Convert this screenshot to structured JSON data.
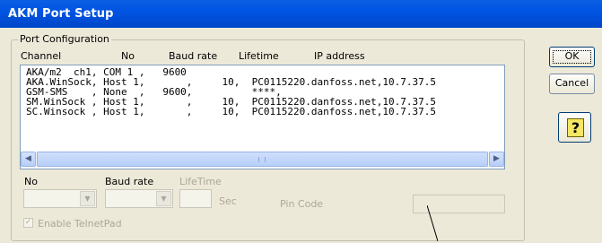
{
  "window": {
    "title": "AKM Port Setup"
  },
  "group": {
    "legend": "Port Configuration"
  },
  "columns": {
    "channel": "Channel",
    "no": "No",
    "baud_rate": "Baud rate",
    "lifetime": "Lifetime",
    "ip_address": "IP address"
  },
  "list": {
    "rows": [
      "AKA/m2  ch1, COM 1 ,   9600",
      "AKA.WinSock, Host 1,       ,     10,  PC0115220.danfoss.net,10.7.37.5",
      "GSM-SMS    , None  ,   9600,          ****,",
      "SM.WinSock , Host 1,       ,     10,  PC0115220.danfoss.net,10.7.37.5",
      "SC.Winsock , Host 1,       ,     10,  PC0115220.danfoss.net,10.7.37.5"
    ]
  },
  "form": {
    "no_label": "No",
    "baud_label": "Baud rate",
    "lifetime_label": "LifeTime",
    "sec_label": "Sec",
    "pin_label": "Pin Code",
    "telnet_label": "Enable TelnetPad",
    "telnet_checked": true
  },
  "buttons": {
    "ok": "OK",
    "cancel": "Cancel",
    "help": "?"
  },
  "icons": {
    "left": "scroll-left-arrow",
    "right": "scroll-right-arrow",
    "dropdown": "chevron-down",
    "help": "help-question-icon"
  },
  "colors": {
    "title_bar": "#0054e3",
    "dialog_bg": "#ece9d8",
    "selection": "#316ac5",
    "disabled_text": "#aca899"
  }
}
